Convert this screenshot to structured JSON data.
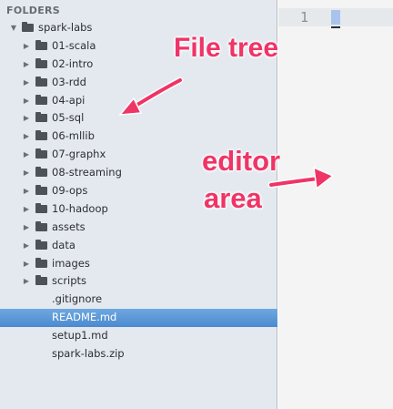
{
  "sidebar": {
    "header": "FOLDERS",
    "root": {
      "label": "spark-labs",
      "expanded": true
    },
    "folders": [
      {
        "label": "01-scala",
        "expanded": false
      },
      {
        "label": "02-intro",
        "expanded": false
      },
      {
        "label": "03-rdd",
        "expanded": false
      },
      {
        "label": "04-api",
        "expanded": false
      },
      {
        "label": "05-sql",
        "expanded": false
      },
      {
        "label": "06-mllib",
        "expanded": false
      },
      {
        "label": "07-graphx",
        "expanded": false
      },
      {
        "label": "08-streaming",
        "expanded": false
      },
      {
        "label": "09-ops",
        "expanded": false
      },
      {
        "label": "10-hadoop",
        "expanded": false
      },
      {
        "label": "assets",
        "expanded": false
      },
      {
        "label": "data",
        "expanded": false
      },
      {
        "label": "images",
        "expanded": false
      },
      {
        "label": "scripts",
        "expanded": false
      }
    ],
    "files": [
      {
        "label": ".gitignore",
        "selected": false
      },
      {
        "label": "README.md",
        "selected": true
      },
      {
        "label": "setup1.md",
        "selected": false
      },
      {
        "label": "spark-labs.zip",
        "selected": false
      }
    ]
  },
  "editor": {
    "line_number": "1"
  },
  "annotations": {
    "file_tree": "File tree",
    "editor_line1": "editor",
    "editor_line2": "area"
  },
  "colors": {
    "annotation": "#ef3466",
    "selection": "#4b8ad0",
    "sidebar_bg": "#e4e9ef",
    "editor_bg": "#f4f4f4"
  }
}
